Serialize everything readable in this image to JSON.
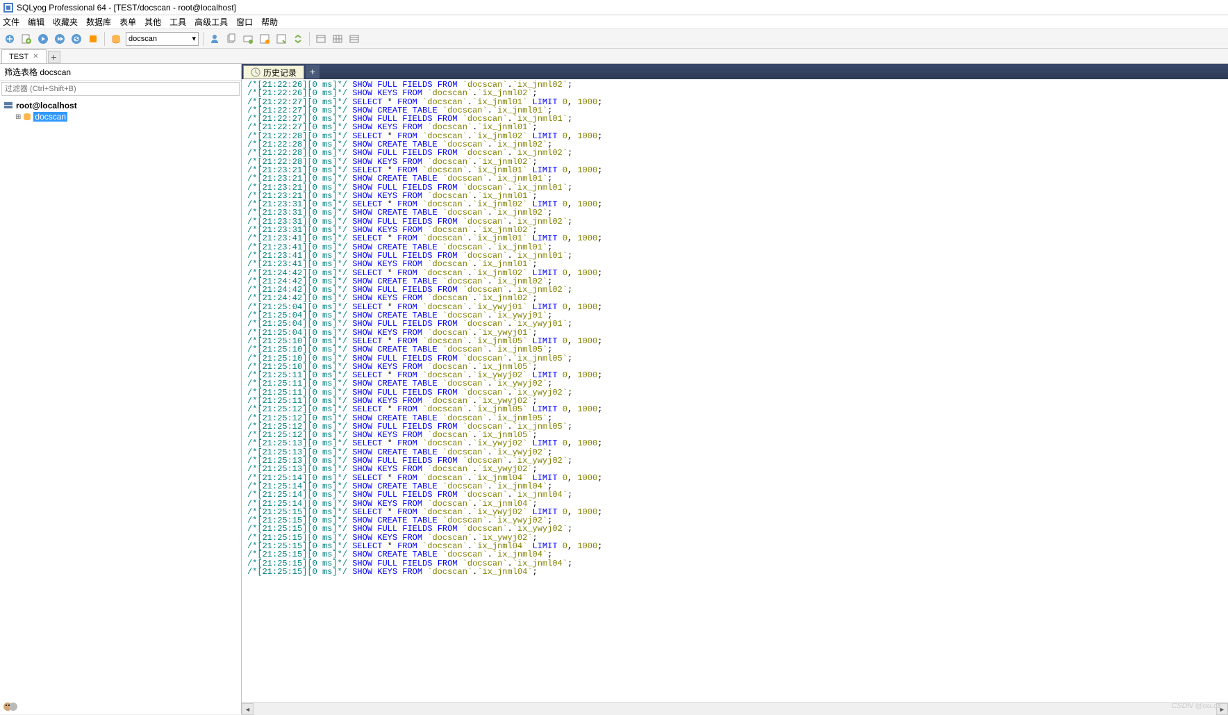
{
  "title": "SQLyog Professional 64 - [TEST/docscan - root@localhost]",
  "menu": [
    "文件",
    "编辑",
    "收藏夹",
    "数据库",
    "表单",
    "其他",
    "工具",
    "高级工具",
    "窗口",
    "帮助"
  ],
  "db_selector": "docscan",
  "tab": {
    "name": "TEST"
  },
  "side": {
    "header_prefix": "筛选表格",
    "header_db": "docscan",
    "filter_placeholder": "过滤器 (Ctrl+Shift+B)",
    "root": "root@localhost",
    "schema_selected": "docscan"
  },
  "content_tab": "历史记录",
  "watermark": "CSDN @ou.cs",
  "history": [
    {
      "t": "21:22:26",
      "q": "SHOW FULL FIELDS FROM",
      "o": "`docscan`.`ix_jnml02`;"
    },
    {
      "t": "21:22:26",
      "q": "SHOW KEYS FROM",
      "o": "`docscan`.`ix_jnml02`;"
    },
    {
      "t": "21:22:27",
      "q": "SELECT * FROM",
      "o": "`docscan`.`ix_jnml01` LIMIT 0, 1000;"
    },
    {
      "t": "21:22:27",
      "q": "SHOW CREATE TABLE",
      "o": "`docscan`.`ix_jnml01`;"
    },
    {
      "t": "21:22:27",
      "q": "SHOW FULL FIELDS FROM",
      "o": "`docscan`.`ix_jnml01`;"
    },
    {
      "t": "21:22:27",
      "q": "SHOW KEYS FROM",
      "o": "`docscan`.`ix_jnml01`;"
    },
    {
      "t": "21:22:28",
      "q": "SELECT * FROM",
      "o": "`docscan`.`ix_jnml02` LIMIT 0, 1000;"
    },
    {
      "t": "21:22:28",
      "q": "SHOW CREATE TABLE",
      "o": "`docscan`.`ix_jnml02`;"
    },
    {
      "t": "21:22:28",
      "q": "SHOW FULL FIELDS FROM",
      "o": "`docscan`.`ix_jnml02`;"
    },
    {
      "t": "21:22:28",
      "q": "SHOW KEYS FROM",
      "o": "`docscan`.`ix_jnml02`;"
    },
    {
      "t": "21:23:21",
      "q": "SELECT * FROM",
      "o": "`docscan`.`ix_jnml01` LIMIT 0, 1000;"
    },
    {
      "t": "21:23:21",
      "q": "SHOW CREATE TABLE",
      "o": "`docscan`.`ix_jnml01`;"
    },
    {
      "t": "21:23:21",
      "q": "SHOW FULL FIELDS FROM",
      "o": "`docscan`.`ix_jnml01`;"
    },
    {
      "t": "21:23:21",
      "q": "SHOW KEYS FROM",
      "o": "`docscan`.`ix_jnml01`;"
    },
    {
      "t": "21:23:31",
      "q": "SELECT * FROM",
      "o": "`docscan`.`ix_jnml02` LIMIT 0, 1000;"
    },
    {
      "t": "21:23:31",
      "q": "SHOW CREATE TABLE",
      "o": "`docscan`.`ix_jnml02`;"
    },
    {
      "t": "21:23:31",
      "q": "SHOW FULL FIELDS FROM",
      "o": "`docscan`.`ix_jnml02`;"
    },
    {
      "t": "21:23:31",
      "q": "SHOW KEYS FROM",
      "o": "`docscan`.`ix_jnml02`;"
    },
    {
      "t": "21:23:41",
      "q": "SELECT * FROM",
      "o": "`docscan`.`ix_jnml01` LIMIT 0, 1000;"
    },
    {
      "t": "21:23:41",
      "q": "SHOW CREATE TABLE",
      "o": "`docscan`.`ix_jnml01`;"
    },
    {
      "t": "21:23:41",
      "q": "SHOW FULL FIELDS FROM",
      "o": "`docscan`.`ix_jnml01`;"
    },
    {
      "t": "21:23:41",
      "q": "SHOW KEYS FROM",
      "o": "`docscan`.`ix_jnml01`;"
    },
    {
      "t": "21:24:42",
      "q": "SELECT * FROM",
      "o": "`docscan`.`ix_jnml02` LIMIT 0, 1000;"
    },
    {
      "t": "21:24:42",
      "q": "SHOW CREATE TABLE",
      "o": "`docscan`.`ix_jnml02`;"
    },
    {
      "t": "21:24:42",
      "q": "SHOW FULL FIELDS FROM",
      "o": "`docscan`.`ix_jnml02`;"
    },
    {
      "t": "21:24:42",
      "q": "SHOW KEYS FROM",
      "o": "`docscan`.`ix_jnml02`;"
    },
    {
      "t": "21:25:04",
      "q": "SELECT * FROM",
      "o": "`docscan`.`ix_ywyj01` LIMIT 0, 1000;"
    },
    {
      "t": "21:25:04",
      "q": "SHOW CREATE TABLE",
      "o": "`docscan`.`ix_ywyj01`;"
    },
    {
      "t": "21:25:04",
      "q": "SHOW FULL FIELDS FROM",
      "o": "`docscan`.`ix_ywyj01`;"
    },
    {
      "t": "21:25:04",
      "q": "SHOW KEYS FROM",
      "o": "`docscan`.`ix_ywyj01`;"
    },
    {
      "t": "21:25:10",
      "q": "SELECT * FROM",
      "o": "`docscan`.`ix_jnml05` LIMIT 0, 1000;"
    },
    {
      "t": "21:25:10",
      "q": "SHOW CREATE TABLE",
      "o": "`docscan`.`ix_jnml05`;"
    },
    {
      "t": "21:25:10",
      "q": "SHOW FULL FIELDS FROM",
      "o": "`docscan`.`ix_jnml05`;"
    },
    {
      "t": "21:25:10",
      "q": "SHOW KEYS FROM",
      "o": "`docscan`.`ix_jnml05`;"
    },
    {
      "t": "21:25:11",
      "q": "SELECT * FROM",
      "o": "`docscan`.`ix_ywyj02` LIMIT 0, 1000;"
    },
    {
      "t": "21:25:11",
      "q": "SHOW CREATE TABLE",
      "o": "`docscan`.`ix_ywyj02`;"
    },
    {
      "t": "21:25:11",
      "q": "SHOW FULL FIELDS FROM",
      "o": "`docscan`.`ix_ywyj02`;"
    },
    {
      "t": "21:25:11",
      "q": "SHOW KEYS FROM",
      "o": "`docscan`.`ix_ywyj02`;"
    },
    {
      "t": "21:25:12",
      "q": "SELECT * FROM",
      "o": "`docscan`.`ix_jnml05` LIMIT 0, 1000;"
    },
    {
      "t": "21:25:12",
      "q": "SHOW CREATE TABLE",
      "o": "`docscan`.`ix_jnml05`;"
    },
    {
      "t": "21:25:12",
      "q": "SHOW FULL FIELDS FROM",
      "o": "`docscan`.`ix_jnml05`;"
    },
    {
      "t": "21:25:12",
      "q": "SHOW KEYS FROM",
      "o": "`docscan`.`ix_jnml05`;"
    },
    {
      "t": "21:25:13",
      "q": "SELECT * FROM",
      "o": "`docscan`.`ix_ywyj02` LIMIT 0, 1000;"
    },
    {
      "t": "21:25:13",
      "q": "SHOW CREATE TABLE",
      "o": "`docscan`.`ix_ywyj02`;"
    },
    {
      "t": "21:25:13",
      "q": "SHOW FULL FIELDS FROM",
      "o": "`docscan`.`ix_ywyj02`;"
    },
    {
      "t": "21:25:13",
      "q": "SHOW KEYS FROM",
      "o": "`docscan`.`ix_ywyj02`;"
    },
    {
      "t": "21:25:14",
      "q": "SELECT * FROM",
      "o": "`docscan`.`ix_jnml04` LIMIT 0, 1000;"
    },
    {
      "t": "21:25:14",
      "q": "SHOW CREATE TABLE",
      "o": "`docscan`.`ix_jnml04`;"
    },
    {
      "t": "21:25:14",
      "q": "SHOW FULL FIELDS FROM",
      "o": "`docscan`.`ix_jnml04`;"
    },
    {
      "t": "21:25:14",
      "q": "SHOW KEYS FROM",
      "o": "`docscan`.`ix_jnml04`;"
    },
    {
      "t": "21:25:15",
      "q": "SELECT * FROM",
      "o": "`docscan`.`ix_ywyj02` LIMIT 0, 1000;"
    },
    {
      "t": "21:25:15",
      "q": "SHOW CREATE TABLE",
      "o": "`docscan`.`ix_ywyj02`;"
    },
    {
      "t": "21:25:15",
      "q": "SHOW FULL FIELDS FROM",
      "o": "`docscan`.`ix_ywyj02`;"
    },
    {
      "t": "21:25:15",
      "q": "SHOW KEYS FROM",
      "o": "`docscan`.`ix_ywyj02`;"
    },
    {
      "t": "21:25:15",
      "q": "SELECT * FROM",
      "o": "`docscan`.`ix_jnml04` LIMIT 0, 1000;"
    },
    {
      "t": "21:25:15",
      "q": "SHOW CREATE TABLE",
      "o": "`docscan`.`ix_jnml04`;"
    },
    {
      "t": "21:25:15",
      "q": "SHOW FULL FIELDS FROM",
      "o": "`docscan`.`ix_jnml04`;"
    },
    {
      "t": "21:25:15",
      "q": "SHOW KEYS FROM",
      "o": "`docscan`.`ix_jnml04`;"
    }
  ]
}
